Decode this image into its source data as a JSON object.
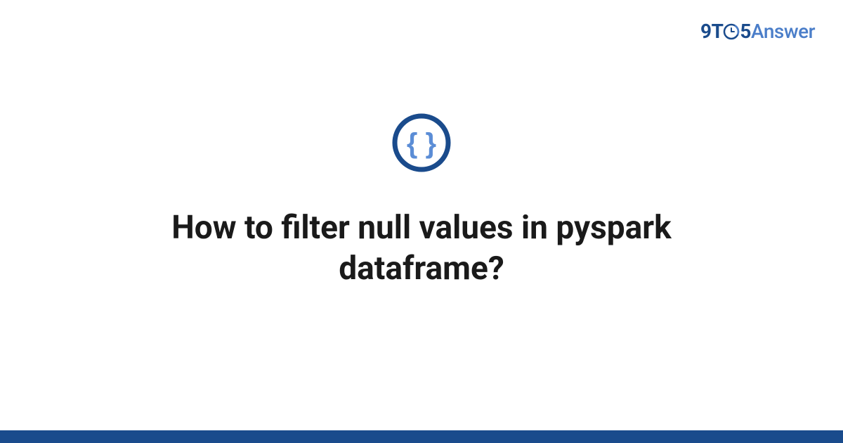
{
  "logo": {
    "prefix": "9T",
    "digit5": "5",
    "suffix": "Answer"
  },
  "icon": {
    "name": "code-braces-icon"
  },
  "question": {
    "title": "How to filter null values in pyspark dataframe?"
  },
  "colors": {
    "brand_dark": "#1a4b8c",
    "brand_light": "#4b7ec9",
    "text": "#1a1a1a"
  }
}
